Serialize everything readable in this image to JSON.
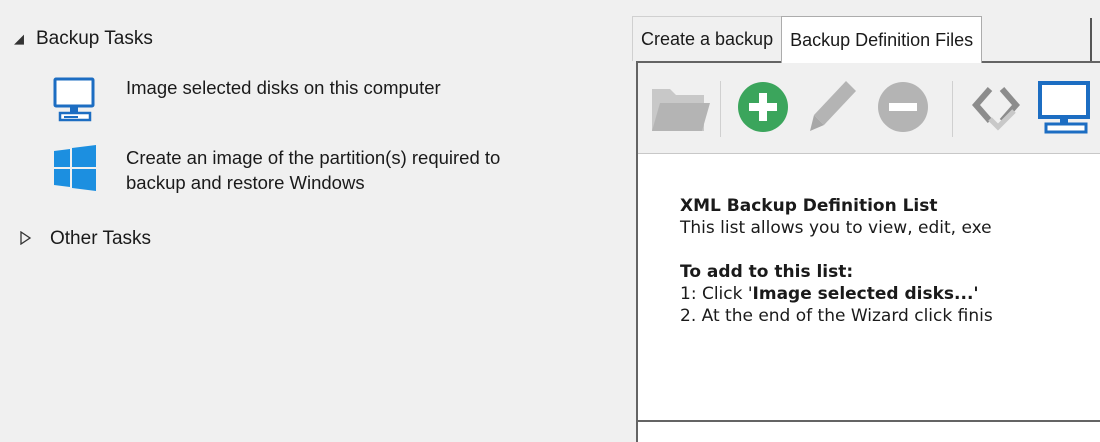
{
  "left": {
    "backup_tasks": {
      "label": "Backup Tasks",
      "expanded": true
    },
    "tasks": [
      {
        "lines": [
          "Image selected disks on this computer"
        ],
        "icon": "monitor-icon"
      },
      {
        "lines": [
          "Create an image of the partition(s) required to",
          "backup and restore Windows"
        ],
        "icon": "windows-logo-icon"
      }
    ],
    "other_tasks": {
      "label": "Other Tasks",
      "expanded": false
    }
  },
  "tabs": [
    {
      "label": "Create a backup",
      "active": false
    },
    {
      "label": "Backup Definition Files",
      "active": true
    }
  ],
  "toolbar": {
    "buttons": [
      {
        "icon": "open-folder-icon",
        "enabled": false
      },
      {
        "icon": "add-icon",
        "enabled": true
      },
      {
        "icon": "edit-icon",
        "enabled": false
      },
      {
        "icon": "remove-icon",
        "enabled": false
      },
      {
        "icon": "xml-code-icon",
        "enabled": false
      },
      {
        "icon": "computer-icon",
        "enabled": true
      }
    ]
  },
  "info": {
    "heading": "XML Backup Definition List",
    "description": "This list allows you to view, edit, exe",
    "add_heading": "To add to this list:",
    "step1_prefix": "1: Click  '",
    "step1_bold": "Image selected disks...'",
    "step2": "2. At the end of the Wizard click finis"
  },
  "colors": {
    "accent_blue": "#1c6dc2",
    "add_green": "#3ba55c",
    "disabled_gray": "#b4b4b4",
    "panel_border": "#646464"
  }
}
